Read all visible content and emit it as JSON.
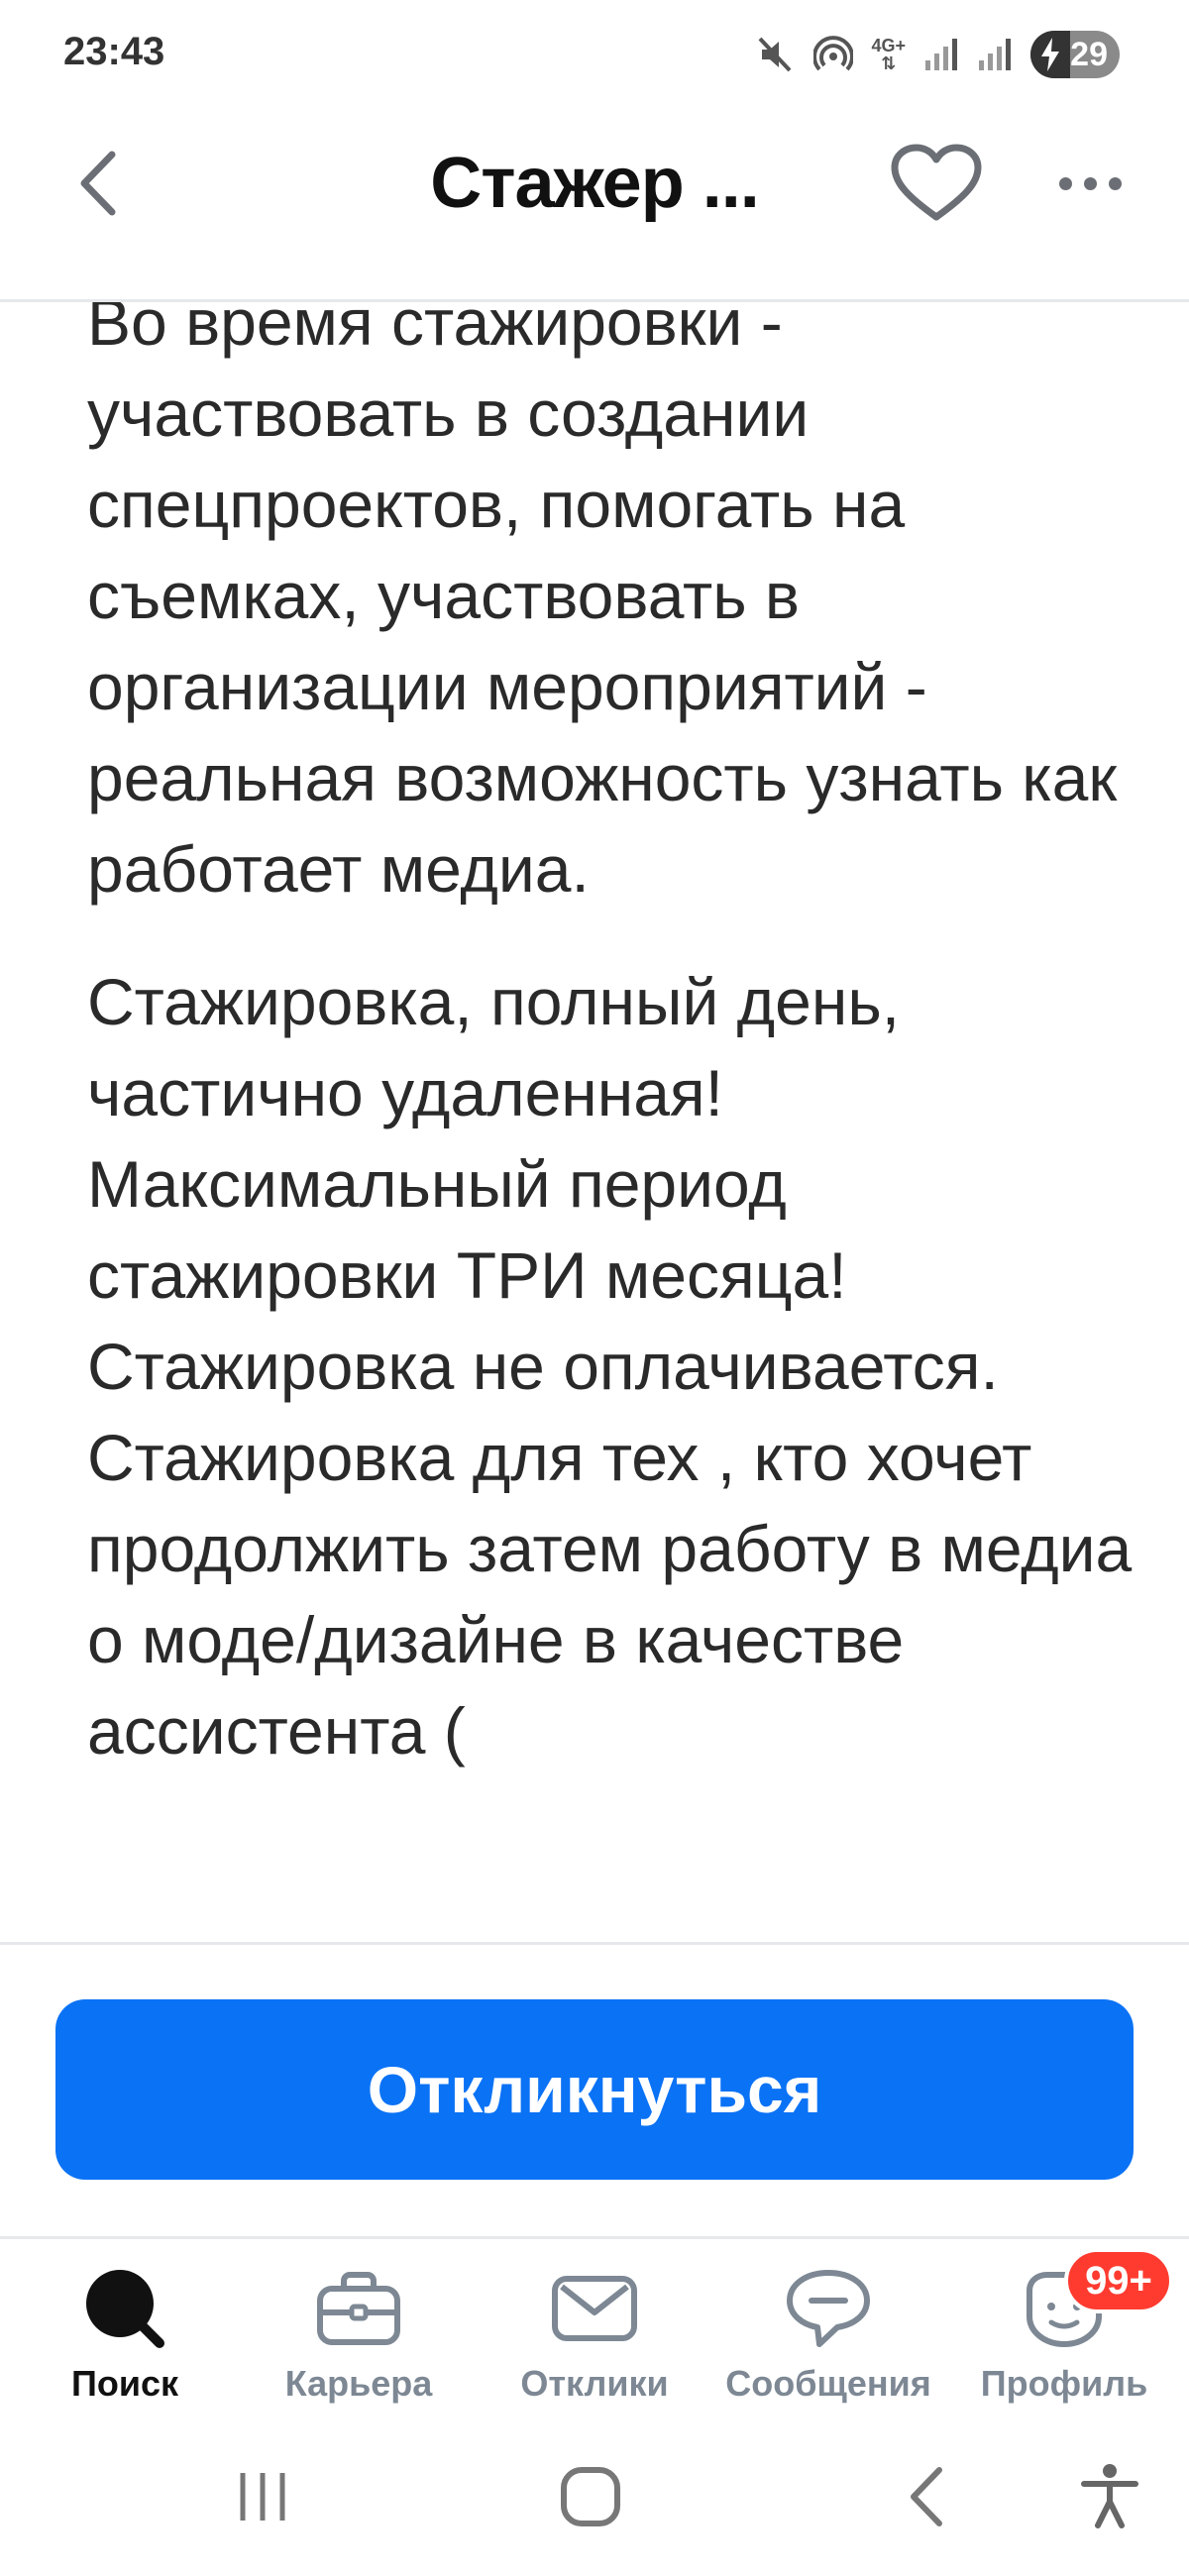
{
  "status_bar": {
    "time": "23:43",
    "network_label": "4G+",
    "battery": "29",
    "icons": [
      "mute-icon",
      "hotspot-icon",
      "network-4g-icon",
      "signal-icon",
      "signal-icon",
      "battery-icon"
    ]
  },
  "header": {
    "title": "Стажер ...",
    "back_icon": "chevron-left-icon",
    "favorite_icon": "heart-icon",
    "more_icon": "more-dots-icon"
  },
  "content": {
    "paragraphs": [
      "Во время стажировки - участвовать в создании спецпроектов, помогать на съемках, участвовать в организации мероприятий - реальная возможность узнать как работает медиа.",
      "Стажировка, полный день, частично удаленная! Максимальный период стажировки ТРИ месяца! Стажировка не оплачивается. Стажировка для тех , кто хочет продолжить затем работу в медиа о моде/дизайне в качестве ассистента ("
    ]
  },
  "respond_button": {
    "label": "Откликнуться",
    "color": "#0a72f5"
  },
  "bottom_nav": {
    "items": [
      {
        "label": "Поиск",
        "icon": "search-icon",
        "active": true
      },
      {
        "label": "Карьера",
        "icon": "briefcase-icon",
        "active": false
      },
      {
        "label": "Отклики",
        "icon": "envelope-icon",
        "active": false
      },
      {
        "label": "Сообщения",
        "icon": "chat-bubble-icon",
        "active": false
      },
      {
        "label": "Профиль",
        "icon": "profile-face-icon",
        "active": false,
        "badge": "99+"
      }
    ]
  },
  "system_nav": {
    "icons": [
      "recent-apps-icon",
      "home-icon",
      "back-icon",
      "accessibility-icon"
    ]
  },
  "colors": {
    "accent": "#0a72f5",
    "badge": "#ff3b30",
    "nav_inactive": "#7d8894",
    "divider": "#e6e8eb"
  }
}
